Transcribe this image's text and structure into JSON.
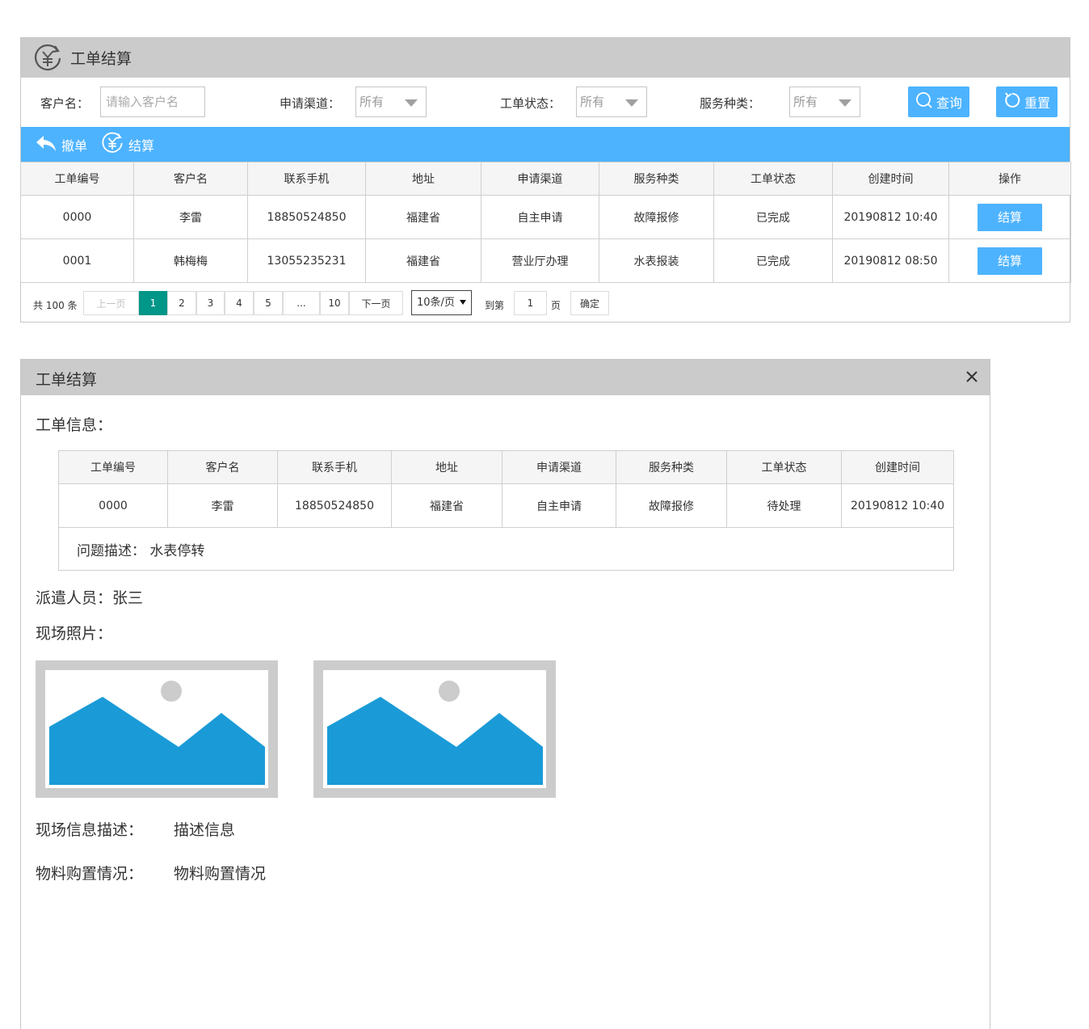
{
  "page": {
    "title": "工单结算"
  },
  "filters": {
    "customer_label": "客户名：",
    "customer_placeholder": "请输入客户名",
    "channel_label": "申请渠道：",
    "channel_value": "所有",
    "status_label": "工单状态：",
    "status_value": "所有",
    "service_label": "服务种类：",
    "service_value": "所有",
    "query_label": "查询",
    "reset_label": "重置"
  },
  "actions": {
    "revoke_label": "撤单",
    "settle_label": "结算"
  },
  "table": {
    "headers": [
      "工单编号",
      "客户名",
      "联系手机",
      "地址",
      "申请渠道",
      "服务种类",
      "工单状态",
      "创建时间",
      "操作"
    ],
    "rows": [
      {
        "id": "0000",
        "customer": "李雷",
        "phone": "18850524850",
        "address": "福建省",
        "channel": "自主申请",
        "service": "故障报修",
        "status": "已完成",
        "created": "20190812  10:40",
        "action": "结算"
      },
      {
        "id": "0001",
        "customer": "韩梅梅",
        "phone": "13055235231",
        "address": "福建省",
        "channel": "营业厅办理",
        "service": "水表报装",
        "status": "已完成",
        "created": "20190812  08:50",
        "action": "结算"
      }
    ]
  },
  "pager": {
    "total": "共 100 条",
    "prev": "上一页",
    "pages": [
      "1",
      "2",
      "3",
      "4",
      "5",
      "...",
      "10"
    ],
    "current": "1",
    "next": "下一页",
    "page_size": "10条/页",
    "goto_prefix": "到第",
    "goto_value": "1",
    "goto_suffix": "页",
    "confirm": "确定"
  },
  "dialog": {
    "title": "工单结算",
    "info_label": "工单信息：",
    "headers": [
      "工单编号",
      "客户名",
      "联系手机",
      "地址",
      "申请渠道",
      "服务种类",
      "工单状态",
      "创建时间"
    ],
    "row": {
      "id": "0000",
      "customer": "李雷",
      "phone": "18850524850",
      "address": "福建省",
      "channel": "自主申请",
      "service": "故障报修",
      "status": "待处理",
      "created": "20190812  10:40"
    },
    "problem_label": "问题描述：",
    "problem_value": "水表停转",
    "dispatch_label": "派遣人员：",
    "dispatch_value": "张三",
    "photos_label": "现场照片：",
    "scene_desc_label": "现场信息描述：",
    "scene_desc_value": "描述信息",
    "material_label": "物料购置情况：",
    "material_value": "物料购置情况"
  },
  "colors": {
    "accent": "#4db3ff",
    "pager_active": "#009688",
    "title_bar": "#cbcbcb",
    "image_placeholder": "#1a9bd7"
  },
  "icons": [
    "yen-refresh-icon",
    "search-icon",
    "refresh-icon",
    "undo-arrow-icon",
    "close-icon",
    "image-placeholder-icon"
  ]
}
